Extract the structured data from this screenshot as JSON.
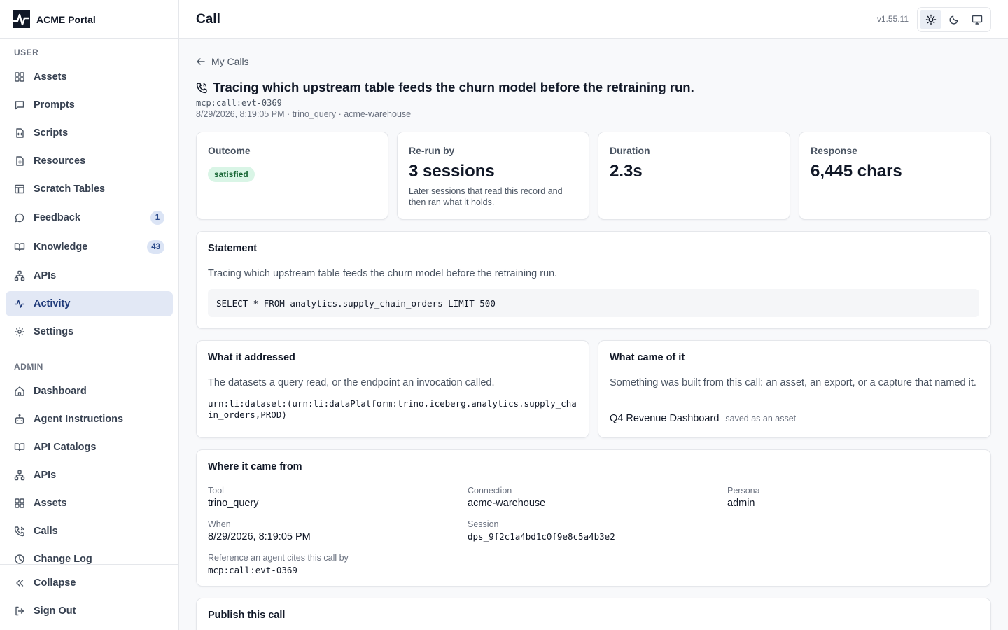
{
  "app": {
    "name": "ACME Portal"
  },
  "sidebar": {
    "user_label": "USER",
    "admin_label": "ADMIN",
    "user_items": [
      {
        "label": "Assets",
        "icon": "grid-icon"
      },
      {
        "label": "Prompts",
        "icon": "message-square-icon"
      },
      {
        "label": "Scripts",
        "icon": "file-code-icon"
      },
      {
        "label": "Resources",
        "icon": "file-plus-icon"
      },
      {
        "label": "Scratch Tables",
        "icon": "table-icon"
      },
      {
        "label": "Feedback",
        "icon": "message-circle-icon",
        "badge": "1"
      },
      {
        "label": "Knowledge",
        "icon": "book-open-icon",
        "badge": "43"
      },
      {
        "label": "APIs",
        "icon": "network-icon"
      },
      {
        "label": "Activity",
        "icon": "activity-icon",
        "active": true
      },
      {
        "label": "Settings",
        "icon": "gear-icon"
      }
    ],
    "admin_items": [
      {
        "label": "Dashboard",
        "icon": "home-icon"
      },
      {
        "label": "Agent Instructions",
        "icon": "bot-icon"
      },
      {
        "label": "API Catalogs",
        "icon": "book-open-icon"
      },
      {
        "label": "APIs",
        "icon": "network-icon"
      },
      {
        "label": "Assets",
        "icon": "grid-icon"
      },
      {
        "label": "Calls",
        "icon": "phone-call-icon"
      },
      {
        "label": "Change Log",
        "icon": "clock-icon"
      }
    ],
    "collapse_label": "Collapse",
    "signout_label": "Sign Out"
  },
  "header": {
    "title": "Call",
    "version": "v1.55.11",
    "theme_options": [
      "light",
      "dark",
      "system"
    ],
    "active_theme": "light"
  },
  "page": {
    "back_label": "My Calls",
    "title": "Tracing which upstream table feeds the churn model before the retraining run.",
    "call_id": "mcp:call:evt-0369",
    "meta": "8/29/2026, 8:19:05 PM · trino_query · acme-warehouse"
  },
  "stats": {
    "outcome": {
      "label": "Outcome",
      "badge": "satisfied",
      "badge_color": "#d9f5e6"
    },
    "rerun": {
      "label": "Re-run by",
      "value": "3 sessions",
      "note": "Later sessions that read this record and then ran what it holds."
    },
    "duration": {
      "label": "Duration",
      "value": "2.3s"
    },
    "response": {
      "label": "Response",
      "value": "6,445 chars"
    }
  },
  "statement": {
    "title": "Statement",
    "text": "Tracing which upstream table feeds the churn model before the retraining run.",
    "sql": "SELECT * FROM analytics.supply_chain_orders LIMIT 500"
  },
  "addressed": {
    "title": "What it addressed",
    "text": "The datasets a query read, or the endpoint an invocation called.",
    "urn": "urn:li:dataset:(urn:li:dataPlatform:trino,iceberg.analytics.supply_chain_orders,PROD)"
  },
  "outcome_card": {
    "title": "What came of it",
    "text": "Something was built from this call: an asset, an export, or a capture that named it.",
    "result_name": "Q4 Revenue Dashboard",
    "result_tag": "saved as an asset"
  },
  "origin": {
    "title": "Where it came from",
    "tool_label": "Tool",
    "tool": "trino_query",
    "connection_label": "Connection",
    "connection": "acme-warehouse",
    "persona_label": "Persona",
    "persona": "admin",
    "when_label": "When",
    "when": "8/29/2026, 8:19:05 PM",
    "session_label": "Session",
    "session": "dps_9f2c1a4bd1c0f9e8c5a4b3e2",
    "reference_label": "Reference an agent cites this call by",
    "reference": "mcp:call:evt-0369"
  },
  "publish": {
    "title": "Publish this call"
  }
}
